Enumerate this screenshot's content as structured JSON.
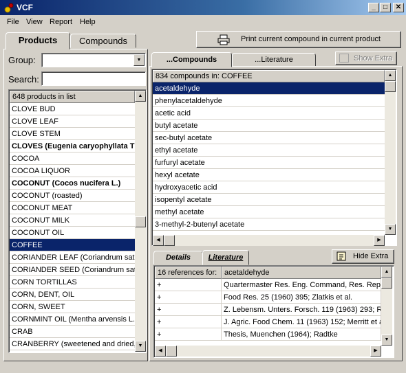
{
  "window": {
    "title": "VCF",
    "minimize": "_",
    "maximize": "□",
    "close": "✕"
  },
  "menu": [
    "File",
    "View",
    "Report",
    "Help"
  ],
  "main_tabs": {
    "products": "Products",
    "compounds": "Compounds"
  },
  "print_button": "Print current compound in current product",
  "filters": {
    "group_label": "Group:",
    "group_value": "",
    "search_label": "Search:",
    "search_value": ""
  },
  "products": {
    "header": "648 products in list",
    "items": [
      {
        "label": "CLOVE BUD",
        "bold": false,
        "selected": false
      },
      {
        "label": "CLOVE LEAF",
        "bold": false,
        "selected": false
      },
      {
        "label": "CLOVE STEM",
        "bold": false,
        "selected": false
      },
      {
        "label": "CLOVES (Eugenia caryophyllata Th",
        "bold": true,
        "selected": false
      },
      {
        "label": "COCOA",
        "bold": false,
        "selected": false
      },
      {
        "label": "COCOA LIQUOR",
        "bold": false,
        "selected": false
      },
      {
        "label": "COCONUT (Cocos nucifera L.)",
        "bold": true,
        "selected": false
      },
      {
        "label": "COCONUT (roasted)",
        "bold": false,
        "selected": false
      },
      {
        "label": "COCONUT MEAT",
        "bold": false,
        "selected": false
      },
      {
        "label": "COCONUT MILK",
        "bold": false,
        "selected": false
      },
      {
        "label": "COCONUT OIL",
        "bold": false,
        "selected": false
      },
      {
        "label": "COFFEE",
        "bold": false,
        "selected": true
      },
      {
        "label": "CORIANDER LEAF (Coriandrum sativu",
        "bold": false,
        "selected": false
      },
      {
        "label": "CORIANDER SEED (Coriandrum sativu",
        "bold": false,
        "selected": false
      },
      {
        "label": "CORN TORTILLAS",
        "bold": false,
        "selected": false
      },
      {
        "label": "CORN, DENT, OIL",
        "bold": false,
        "selected": false
      },
      {
        "label": "CORN, SWEET",
        "bold": false,
        "selected": false
      },
      {
        "label": "CORNMINT OIL (Mentha arvensis L. va",
        "bold": false,
        "selected": false
      },
      {
        "label": "CRAB",
        "bold": false,
        "selected": false
      },
      {
        "label": "CRANBERRY (sweetened and dried,",
        "bold": false,
        "selected": false
      }
    ]
  },
  "sub_tabs": {
    "compounds": "...Compounds",
    "literature": "...Literature",
    "show_extra": "Show Extra"
  },
  "compounds": {
    "header": "834 compounds in: COFFEE",
    "items": [
      {
        "label": "acetaldehyde",
        "selected": true
      },
      {
        "label": "phenylacetaldehyde",
        "selected": false
      },
      {
        "label": "acetic acid",
        "selected": false
      },
      {
        "label": "butyl acetate",
        "selected": false
      },
      {
        "label": "sec-butyl acetate",
        "selected": false
      },
      {
        "label": "ethyl acetate",
        "selected": false
      },
      {
        "label": "furfuryl acetate",
        "selected": false
      },
      {
        "label": "hexyl acetate",
        "selected": false
      },
      {
        "label": "hydroxyacetic acid",
        "selected": false
      },
      {
        "label": "isopentyl acetate",
        "selected": false
      },
      {
        "label": "methyl acetate",
        "selected": false
      },
      {
        "label": "3-methyl-2-butenyl acetate",
        "selected": false
      }
    ]
  },
  "detail_tabs": {
    "details": "Details",
    "literature": "Literature",
    "hide_extra": "Hide Extra"
  },
  "references": {
    "count_label": "16 references for:",
    "compound": "acetaldehyde",
    "rows": [
      {
        "mark": "+",
        "text": "Quartermaster Res. Eng. Command, Res. Rep. A"
      },
      {
        "mark": "+",
        "text": "Food Res. 25 (1960) 395; Zlatkis et al."
      },
      {
        "mark": "+",
        "text": "Z. Lebensm. Unters. Forsch. 119 (1963) 293; R"
      },
      {
        "mark": "+",
        "text": "J. Agric. Food Chem. 11 (1963) 152; Merritt et al"
      },
      {
        "mark": "+",
        "text": "Thesis, Muenchen (1964); Radtke"
      }
    ]
  }
}
